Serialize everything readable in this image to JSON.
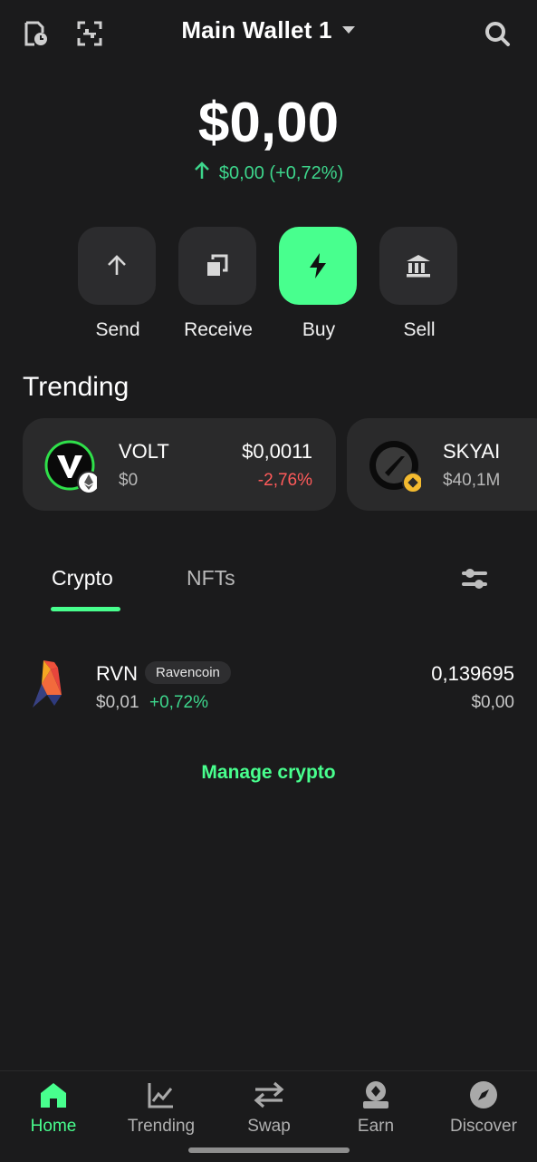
{
  "header": {
    "wallet_title": "Main Wallet 1",
    "left_icons": [
      "history-icon",
      "scan-icon"
    ],
    "right_icon": "search-icon"
  },
  "balance": {
    "amount": "$0,00",
    "change": "$0,00 (+0,72%)",
    "change_color": "#3dd68c"
  },
  "actions": [
    {
      "label": "Send",
      "icon": "arrow-up-icon"
    },
    {
      "label": "Receive",
      "icon": "copy-icon"
    },
    {
      "label": "Buy",
      "icon": "lightning-icon"
    },
    {
      "label": "Sell",
      "icon": "bank-icon"
    }
  ],
  "trending": {
    "title": "Trending",
    "cards": [
      {
        "name": "VOLT",
        "sub": "$0",
        "price": "$0,0011",
        "change": "-2,76%",
        "change_color": "#ff5a5a"
      },
      {
        "name": "SKYAI",
        "sub": "$40,1M"
      }
    ]
  },
  "tabs": [
    {
      "label": "Crypto",
      "active": true
    },
    {
      "label": "NFTs",
      "active": false
    }
  ],
  "assets": [
    {
      "symbol": "RVN",
      "chain": "Ravencoin",
      "price": "$0,01",
      "change": "+0,72%",
      "amount": "0,139695",
      "fiat": "$0,00"
    }
  ],
  "manage_label": "Manage crypto",
  "nav": [
    {
      "label": "Home",
      "icon": "home-icon",
      "active": true
    },
    {
      "label": "Trending",
      "icon": "chart-icon",
      "active": false
    },
    {
      "label": "Swap",
      "icon": "swap-icon",
      "active": false
    },
    {
      "label": "Earn",
      "icon": "earn-icon",
      "active": false
    },
    {
      "label": "Discover",
      "icon": "compass-icon",
      "active": false
    }
  ],
  "colors": {
    "accent": "#48ff8e",
    "background": "#1b1b1c",
    "card": "#2a2a2b"
  }
}
